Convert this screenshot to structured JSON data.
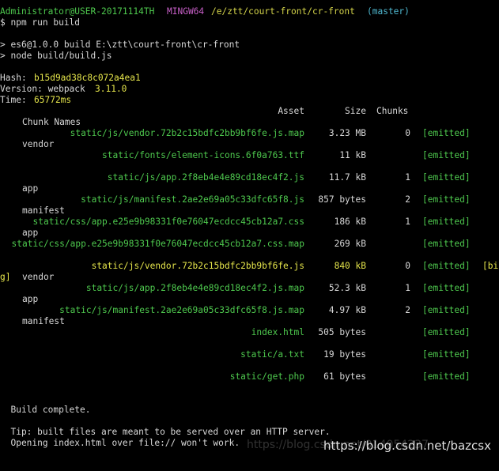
{
  "prompt": {
    "user_host": "Administrator@USER-20171114TH",
    "shell": "MINGW64",
    "path": "/e/ztt/court-front/cr-front",
    "branch": "(master)"
  },
  "command": "$ npm run build",
  "script_lines": [
    "> es6@1.0.0 build E:\\ztt\\court-front\\cr-front",
    "> node build/build.js"
  ],
  "stats": {
    "hash_label": "Hash: ",
    "hash_value": "b15d9ad38c8c072a4ea1",
    "version_label": "Version: webpack ",
    "version_value": "3.11.0",
    "time_label": "Time: ",
    "time_value": "65772ms"
  },
  "table_header": {
    "asset": "Asset",
    "size": "Size",
    "chunks": "Chunks",
    "chunk_names": "Chunk Names"
  },
  "assets": [
    {
      "name": "static/js/vendor.72b2c15bdfc2bb9bf6fe.js.map",
      "size": "3.23 MB",
      "chunk": "0",
      "status": "[emitted]",
      "chunk_name": "vendor",
      "highlight": false
    },
    {
      "name": "static/fonts/element-icons.6f0a763.ttf",
      "size": "11 kB",
      "chunk": "",
      "status": "[emitted]",
      "chunk_name": "",
      "highlight": false
    },
    {
      "name": "static/js/app.2f8eb4e4e89cd18ec4f2.js",
      "size": "11.7 kB",
      "chunk": "1",
      "status": "[emitted]",
      "chunk_name": "app",
      "highlight": false
    },
    {
      "name": "static/js/manifest.2ae2e69a05c33dfc65f8.js",
      "size": "857 bytes",
      "chunk": "2",
      "status": "[emitted]",
      "chunk_name": "manifest",
      "highlight": false
    },
    {
      "name": "static/css/app.e25e9b98331f0e76047ecdcc45cb12a7.css",
      "size": "186 kB",
      "chunk": "1",
      "status": "[emitted]",
      "chunk_name": "app",
      "highlight": false
    },
    {
      "name": "static/css/app.e25e9b98331f0e76047ecdcc45cb12a7.css.map",
      "size": "269 kB",
      "chunk": "",
      "status": "[emitted]",
      "chunk_name": "",
      "highlight": false
    },
    {
      "name": "static/js/vendor.72b2c15bdfc2bb9bf6fe.js",
      "size": "840 kB",
      "chunk": "0",
      "status": "[emitted]",
      "chunk_name": "vendor",
      "highlight": true,
      "big_tag_start": "[bi",
      "big_tag_end": "g]"
    },
    {
      "name": "static/js/app.2f8eb4e4e89cd18ec4f2.js.map",
      "size": "52.3 kB",
      "chunk": "1",
      "status": "[emitted]",
      "chunk_name": "app",
      "highlight": false
    },
    {
      "name": "static/js/manifest.2ae2e69a05c33dfc65f8.js.map",
      "size": "4.97 kB",
      "chunk": "2",
      "status": "[emitted]",
      "chunk_name": "manifest",
      "highlight": false
    },
    {
      "name": "index.html",
      "size": "505 bytes",
      "chunk": "",
      "status": "[emitted]",
      "chunk_name": "",
      "highlight": false
    },
    {
      "name": "static/a.txt",
      "size": "19 bytes",
      "chunk": "",
      "status": "[emitted]",
      "chunk_name": "",
      "highlight": false
    },
    {
      "name": "static/get.php",
      "size": "61 bytes",
      "chunk": "",
      "status": "[emitted]",
      "chunk_name": "",
      "highlight": false
    }
  ],
  "footer": {
    "build_complete": "  Build complete.",
    "tip_line1": "  Tip: built files are meant to be served over an HTTP server.",
    "tip_line2": "  Opening index.html over file:// won't work."
  },
  "watermark": {
    "text": "https://blog.csdn.net/bazcsx",
    "ghost_text": "https://blog.csdn.net/014054237"
  },
  "colors": {
    "background": "#000000",
    "text": "#c0c0c0",
    "green": "#4ec94e",
    "magenta": "#c75fc7",
    "yellow": "#d4d44a",
    "cyan": "#4fb8d0"
  }
}
